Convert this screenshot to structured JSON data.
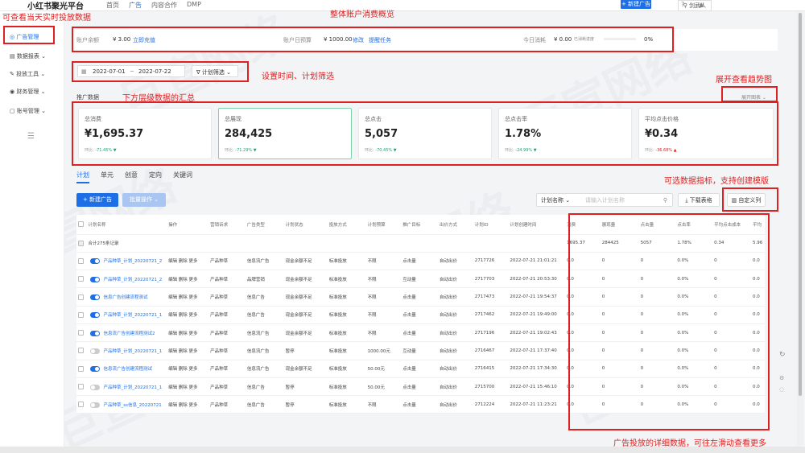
{
  "app": {
    "brand": "小红书聚光平台"
  },
  "nav": {
    "tabs": [
      "首页",
      "广告",
      "内容合作",
      "DMP"
    ],
    "active": "广告"
  },
  "topbar": {
    "account": "剑武人",
    "new_ad": "+ 新建广告",
    "help_icon": "question-circle-icon",
    "bell_icon": "bell-icon"
  },
  "sidebar": {
    "items": [
      {
        "label": "广告管理",
        "icon": "ad-manage-icon"
      },
      {
        "label": "数据报表",
        "icon": "chart-icon"
      },
      {
        "label": "投放工具",
        "icon": "tools-icon"
      },
      {
        "label": "财务管理",
        "icon": "finance-icon"
      },
      {
        "label": "账号管理",
        "icon": "account-icon"
      }
    ],
    "collapse_icon": "menu-collapse-icon"
  },
  "summary": {
    "balance_label": "账户余额",
    "balance_value": "¥ 3.00",
    "balance_link": "立即充值",
    "budget_label": "账户日预算",
    "budget_value": "¥ 1000.00",
    "budget_edit": "修改",
    "budget_link": "提醒任务",
    "today_label": "今日消耗",
    "today_value": "¥ 0.00",
    "today_sub": "已消耗进度",
    "today_pct": "0%"
  },
  "filters": {
    "date_start": "2022-07-01",
    "date_end": "2022-07-22",
    "plan_filter": "计划筛选"
  },
  "promo": {
    "title": "推广数据",
    "expand": "展开图表"
  },
  "metrics": [
    {
      "label": "总消费",
      "value": "¥1,695.37",
      "compare": "环比:",
      "change": "-71.45% ▼",
      "trend": "down"
    },
    {
      "label": "总展现",
      "value": "284,425",
      "compare": "环比:",
      "change": "-71.29% ▼",
      "trend": "down"
    },
    {
      "label": "总点击",
      "value": "5,057",
      "compare": "环比:",
      "change": "-70.45% ▼",
      "trend": "down"
    },
    {
      "label": "总点击率",
      "value": "1.78%",
      "compare": "环比:",
      "change": "-24.99% ▼",
      "trend": "down"
    },
    {
      "label": "平均点击价格",
      "value": "¥0.34",
      "compare": "环比:",
      "change": "-36.68% ▲",
      "trend": "up"
    }
  ],
  "tabs": [
    "计划",
    "单元",
    "创意",
    "定向",
    "关键词"
  ],
  "actions": {
    "new_ad": "+ 新建广告",
    "batch": "批量操作",
    "search_type": "计划名称",
    "search_placeholder": "请输入计划名称",
    "download": "下载表格",
    "custom": "自定义列"
  },
  "table": {
    "headers": [
      "计划名称",
      "操作",
      "营销诉求",
      "广告类型",
      "计划状态",
      "投放方式",
      "计划预算",
      "推广目标",
      "出价方式",
      "计划ID",
      "计划创建时间",
      "消费",
      "展现量",
      "点击量",
      "点击率",
      "平均点击成本",
      "平均"
    ],
    "summary_row": {
      "name": "合计275条记录",
      "cost": "1695.37",
      "impressions": "284425",
      "clicks": "5057",
      "ctr": "1.78%",
      "cpc": "0.34",
      "extra": "5.96"
    },
    "rows": [
      {
        "toggle": true,
        "name": "产品种草_计划_20220721_2",
        "name2": "10540",
        "ops": "编辑  删除  更多",
        "demand": "产品种草",
        "type": "信息流广告",
        "status": "现金余额不足",
        "mode": "标准投放",
        "budget": "不限",
        "goal": "点击量",
        "bid": "自动出价",
        "id": "2717726",
        "time": "2022-07-21 21:01:21",
        "cost": "0.0",
        "imp": "0",
        "clk": "0",
        "ctr": "0.0%",
        "cpc": "0",
        "x": "0.0"
      },
      {
        "toggle": true,
        "name": "产品种草_计划_20220721_2",
        "name2": "05324",
        "ops": "编辑  删除  更多",
        "demand": "产品种草",
        "type": "品牌营销",
        "status": "现金余额不足",
        "mode": "标准投放",
        "budget": "不限",
        "goal": "互动量",
        "bid": "自动出价",
        "id": "2717703",
        "time": "2022-07-21 20:53:30",
        "cost": "0.0",
        "imp": "0",
        "clk": "0",
        "ctr": "0.0%",
        "cpc": "0",
        "x": "0.0"
      },
      {
        "toggle": true,
        "name": "信息广告创建流程测试",
        "name2": "",
        "ops": "编辑  删除  更多",
        "demand": "产品种草",
        "type": "信息广告",
        "status": "现金余额不足",
        "mode": "标准投放",
        "budget": "不限",
        "goal": "点击量",
        "bid": "自动出价",
        "id": "2717473",
        "time": "2022-07-21 19:54:37",
        "cost": "0.0",
        "imp": "0",
        "clk": "0",
        "ctr": "0.0%",
        "cpc": "0",
        "x": "0.0"
      },
      {
        "toggle": true,
        "name": "产品种草_计划_20220721_1",
        "name2": "94854",
        "ops": "编辑  删除  更多",
        "demand": "产品种草",
        "type": "信息广告",
        "status": "现金余额不足",
        "mode": "标准投放",
        "budget": "不限",
        "goal": "点击量",
        "bid": "自动出价",
        "id": "2717462",
        "time": "2022-07-21 19:49:00",
        "cost": "0.0",
        "imp": "0",
        "clk": "0",
        "ctr": "0.0%",
        "cpc": "0",
        "x": "0.0"
      },
      {
        "toggle": true,
        "name": "信息流广告创建流程测试2",
        "name2": "",
        "ops": "编辑  删除  更多",
        "demand": "产品种草",
        "type": "信息流广告",
        "status": "现金余额不足",
        "mode": "标准投放",
        "budget": "不限",
        "goal": "点击量",
        "bid": "自动出价",
        "id": "2717196",
        "time": "2022-07-21 19:02:43",
        "cost": "0.0",
        "imp": "0",
        "clk": "0",
        "ctr": "0.0%",
        "cpc": "0",
        "x": "0.0"
      },
      {
        "toggle": false,
        "name": "产品种草_计划_20220721_1",
        "name2": "73848",
        "ops": "编辑  删除  更多",
        "demand": "产品种草",
        "type": "信息流广告",
        "status": "暂停",
        "mode": "标准投放",
        "budget": "1000.00元",
        "goal": "互动量",
        "bid": "自动出价",
        "id": "2716467",
        "time": "2022-07-21 17:37:40",
        "cost": "0.0",
        "imp": "0",
        "clk": "0",
        "ctr": "0.0%",
        "cpc": "0",
        "x": "0.0"
      },
      {
        "toggle": true,
        "name": "信息流广告创建流程测试",
        "name2": "",
        "ops": "编辑  删除  更多",
        "demand": "产品种草",
        "type": "信息流广告",
        "status": "现金余额不足",
        "mode": "标准投放",
        "budget": "50.00元",
        "goal": "点击量",
        "bid": "自动出价",
        "id": "2716415",
        "time": "2022-07-21 17:34:30",
        "cost": "0.0",
        "imp": "0",
        "clk": "0",
        "ctr": "0.0%",
        "cpc": "0",
        "x": "0.0"
      },
      {
        "toggle": false,
        "name": "产品种草_计划_20220721_1",
        "name2": "63063",
        "ops": "编辑  删除  更多",
        "demand": "产品种草",
        "type": "信息广告",
        "status": "暂停",
        "mode": "标准投放",
        "budget": "50.00元",
        "goal": "点击量",
        "bid": "自动出价",
        "id": "2715700",
        "time": "2022-07-21 15:46:10",
        "cost": "0.0",
        "imp": "0",
        "clk": "0",
        "ctr": "0.0%",
        "cpc": "0",
        "x": "0.0"
      },
      {
        "toggle": false,
        "name": "产品种草_ss信息_20220721",
        "name2": "",
        "ops": "编辑  删除  更多",
        "demand": "产品种草",
        "type": "信息广告",
        "status": "暂停",
        "mode": "标准投放",
        "budget": "不限",
        "goal": "点击量",
        "bid": "自动出价",
        "id": "2712224",
        "time": "2022-07-21 11:23:21",
        "cost": "0.0",
        "imp": "0",
        "clk": "0",
        "ctr": "0.0%",
        "cpc": "0",
        "x": "0.0"
      }
    ]
  },
  "annotations": {
    "a1": "可查看当天实时投放数据",
    "a2": "整体账户消费概览",
    "a3": "设置时间、计划筛选",
    "a4": "展开查看趋势图",
    "a5": "下方层级数据的汇总",
    "a6": "可选数据指标，支持创建模版",
    "a7": "广告投放的详细数据，可往左滑动查看更多"
  },
  "watermark": "巨宣网络"
}
